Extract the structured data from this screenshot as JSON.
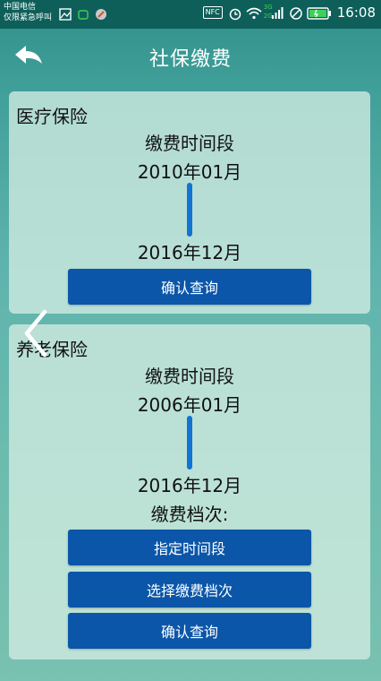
{
  "status_bar": {
    "carrier_line1": "中国电信",
    "carrier_line2": "仅限紧急呼叫",
    "nfc": "NFC",
    "network_3g": "3G",
    "network_2g": "2G",
    "time": "16:08"
  },
  "header": {
    "title": "社保缴费"
  },
  "medical": {
    "title": "医疗保险",
    "period_label": "缴费时间段",
    "start": "2010年01月",
    "end": "2016年12月",
    "confirm_label": "确认查询"
  },
  "pension": {
    "title": "养老保险",
    "period_label": "缴费时间段",
    "start": "2006年01月",
    "end": "2016年12月",
    "level_label": "缴费档次:",
    "specify_period_label": "指定时间段",
    "select_level_label": "选择缴费档次",
    "confirm_label": "确认查询"
  },
  "colors": {
    "accent_blue": "#0b56a8",
    "timeline_blue": "#1173d4"
  }
}
